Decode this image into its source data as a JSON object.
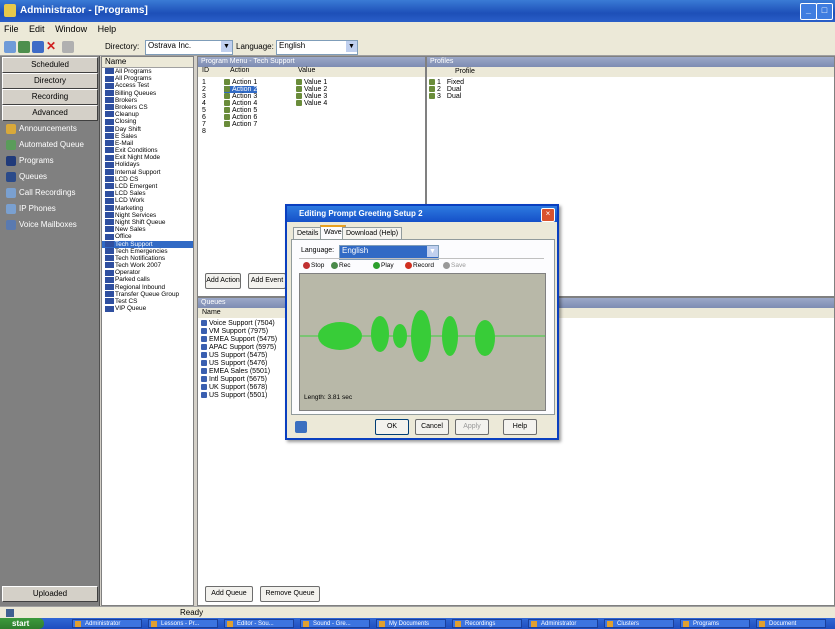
{
  "window": {
    "title": "Administrator - [Programs]",
    "min_label": "_",
    "max_label": "□"
  },
  "menu": [
    "File",
    "Edit",
    "Window",
    "Help"
  ],
  "toolbar": {
    "directory_label": "Directory:",
    "directory_value": "Ostrava Inc.",
    "language_label": "Language:",
    "language_value": "English"
  },
  "leftnav": {
    "buttons": [
      "Scheduled",
      "Directory",
      "Recording",
      "Advanced"
    ],
    "items": [
      "Announcements",
      "Automated Queue",
      "Programs",
      "Queues",
      "Call Recordings",
      "IP Phones",
      "Voice Mailboxes"
    ],
    "bottom_button": "Uploaded"
  },
  "nametree": {
    "header": "Name",
    "items": [
      "All Programs",
      "All Programs",
      "Access Test",
      "Billing Queues",
      "Brokers",
      "Brokers CS",
      "Cleanup",
      "Closing",
      "Day Shift",
      "E Sales",
      "E-Mail",
      "Exit Conditions",
      "Exit Night Mode",
      "Holidays",
      "Internal Support",
      "LCD CS",
      "LCD Emergent",
      "LCD Sales",
      "LCD Work",
      "Marketing",
      "Night Services",
      "Night Shift Queue",
      "New Sales",
      "Office",
      "Tech Support",
      "Tech Emergencies",
      "Tech Notifications",
      "Tech Work 2007",
      "Operator",
      "Parked calls",
      "Regional Inbound",
      "Transfer Queue Group",
      "Test CS",
      "VIP Queue"
    ],
    "selected_index": 24
  },
  "program": {
    "header": "Program Menu - Tech Support",
    "col_id": "ID",
    "col_action": "Action",
    "col_value": "Value",
    "ids": [
      "1",
      "2",
      "3",
      "4",
      "5",
      "6",
      "7",
      "8"
    ],
    "actions": [
      "Action 1",
      "Action 2",
      "Action 3",
      "Action 4",
      "Action 5",
      "Action 6",
      "Action 7"
    ],
    "values": [
      "Value 1",
      "Value 2",
      "Value 3",
      "Value 4"
    ],
    "selected_action_index": 1,
    "add_label": "Add Action",
    "add2_label": "Add Event"
  },
  "profiles": {
    "header": "Profiles",
    "col_label": "Profile",
    "rows": [
      {
        "id": "1",
        "name": "Fixed"
      },
      {
        "id": "2",
        "name": "Dual"
      },
      {
        "id": "3",
        "name": "Dual"
      }
    ]
  },
  "queues": {
    "header": "Queues",
    "col_label": "Name",
    "items": [
      "Voice Support (7504)",
      "VM Support (7975)",
      "EMEA Support (5475)",
      "APAC Support (5975)",
      "US Support (5475)",
      "US Support (5476)",
      "EMEA Sales (5501)",
      "Intl Support (5675)",
      "UK Support (5678)",
      "US Support (5501)"
    ],
    "add_label": "Add Queue",
    "remove_label": "Remove Queue"
  },
  "status": {
    "text": "Ready"
  },
  "taskbar": {
    "start": "start",
    "tasks": [
      "Administrator",
      "Lessons - Pr...",
      "Editor - Sou...",
      "Sound - Gre...",
      "My Documents",
      "Recordings",
      "Administrator",
      "Clusters",
      "Programs",
      "Document"
    ]
  },
  "dialog": {
    "title": "Editing Prompt Greeting Setup 2",
    "close_label": "×",
    "tabs": [
      "Details",
      "Wave",
      "Download (Help)"
    ],
    "active_tab": 1,
    "language_label": "Language:",
    "language_value": "English",
    "wave_buttons": [
      "Stop",
      "Rec",
      "Play",
      "Record",
      "Save"
    ],
    "duration": "Length: 3.81 sec",
    "ok_label": "OK",
    "cancel_label": "Cancel",
    "apply_label": "Apply",
    "help_label": "Help"
  },
  "colors": {
    "accent": "#316ac5",
    "waveform": "#2cc52c",
    "titlebar": "#1d4fb8"
  }
}
